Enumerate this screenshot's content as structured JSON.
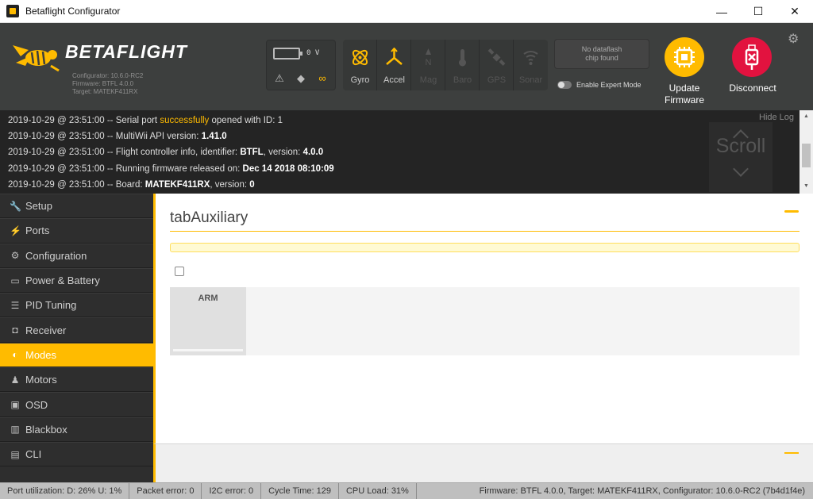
{
  "window": {
    "title": "Betaflight Configurator",
    "minimize": "—",
    "maximize": "☐",
    "close": "✕"
  },
  "header": {
    "logo_text": "BETAFLIGHT",
    "configurator_version": "Configurator: 10.6.0-RC2",
    "firmware": "Firmware: BTFL 4.0.0",
    "target": "Target: MATEKF411RX",
    "battery_voltage": "0 V",
    "sensors": [
      {
        "label": "Gyro",
        "active": true
      },
      {
        "label": "Accel",
        "active": true
      },
      {
        "label": "Mag",
        "active": false
      },
      {
        "label": "Baro",
        "active": false
      },
      {
        "label": "GPS",
        "active": false
      },
      {
        "label": "Sonar",
        "active": false
      }
    ],
    "dataflash_line1": "No dataflash",
    "dataflash_line2": "chip found",
    "expert_mode_label": "Enable Expert Mode",
    "update_line1": "Update",
    "update_line2": "Firmware",
    "disconnect_label": "Disconnect"
  },
  "log": {
    "hide_label": "Hide Log",
    "scroll_label": "Scroll",
    "lines": [
      {
        "prefix": "2019-10-29 @ 23:51:00 -- Serial port ",
        "highlight": "successfully",
        "suffix": " opened with ID: 1"
      },
      {
        "prefix": "2019-10-29 @ 23:51:00 -- MultiWii API version: ",
        "bold": "1.41.0"
      },
      {
        "prefix": "2019-10-29 @ 23:51:00 -- Flight controller info, identifier: ",
        "bold": "BTFL",
        "mid": ", version: ",
        "bold2": "4.0.0"
      },
      {
        "prefix": "2019-10-29 @ 23:51:00 -- Running firmware released on: ",
        "bold": "Dec 14 2018 08:10:09"
      },
      {
        "prefix": "2019-10-29 @ 23:51:00 -- Board: ",
        "bold": "MATEKF411RX",
        "mid": ", version: ",
        "bold2": "0"
      }
    ]
  },
  "sidebar": {
    "items": [
      {
        "label": "Setup",
        "icon": "wrench-icon",
        "glyph": "🔧"
      },
      {
        "label": "Ports",
        "icon": "plug-icon",
        "glyph": "⚡"
      },
      {
        "label": "Configuration",
        "icon": "gear-icon",
        "glyph": "⚙"
      },
      {
        "label": "Power & Battery",
        "icon": "battery-icon",
        "glyph": "▭"
      },
      {
        "label": "PID Tuning",
        "icon": "sliders-icon",
        "glyph": "☰"
      },
      {
        "label": "Receiver",
        "icon": "radio-icon",
        "glyph": "◘"
      },
      {
        "label": "Modes",
        "icon": "toggle-icon",
        "glyph": "◐"
      },
      {
        "label": "Motors",
        "icon": "motor-icon",
        "glyph": "♟"
      },
      {
        "label": "OSD",
        "icon": "osd-icon",
        "glyph": "▣"
      },
      {
        "label": "Blackbox",
        "icon": "blackbox-icon",
        "glyph": "▥"
      },
      {
        "label": "CLI",
        "icon": "terminal-icon",
        "glyph": "▤"
      }
    ],
    "active_index": 6
  },
  "content": {
    "tab_title": "tabAuxiliary",
    "mode_name": "ARM"
  },
  "status": {
    "port_utilization": "Port utilization: D: 26% U: 1%",
    "packet_error": "Packet error: 0",
    "i2c_error": "I2C error: 0",
    "cycle_time": "Cycle Time: 129",
    "cpu_load": "CPU Load: 31%",
    "version": "Firmware: BTFL 4.0.0, Target: MATEKF411RX, Configurator: 10.6.0-RC2 (7b4d1f4e)"
  },
  "colors": {
    "accent": "#ffbb00",
    "header_bg": "#3d3f3e",
    "log_bg": "#242424",
    "disconnect": "#e2123f"
  }
}
